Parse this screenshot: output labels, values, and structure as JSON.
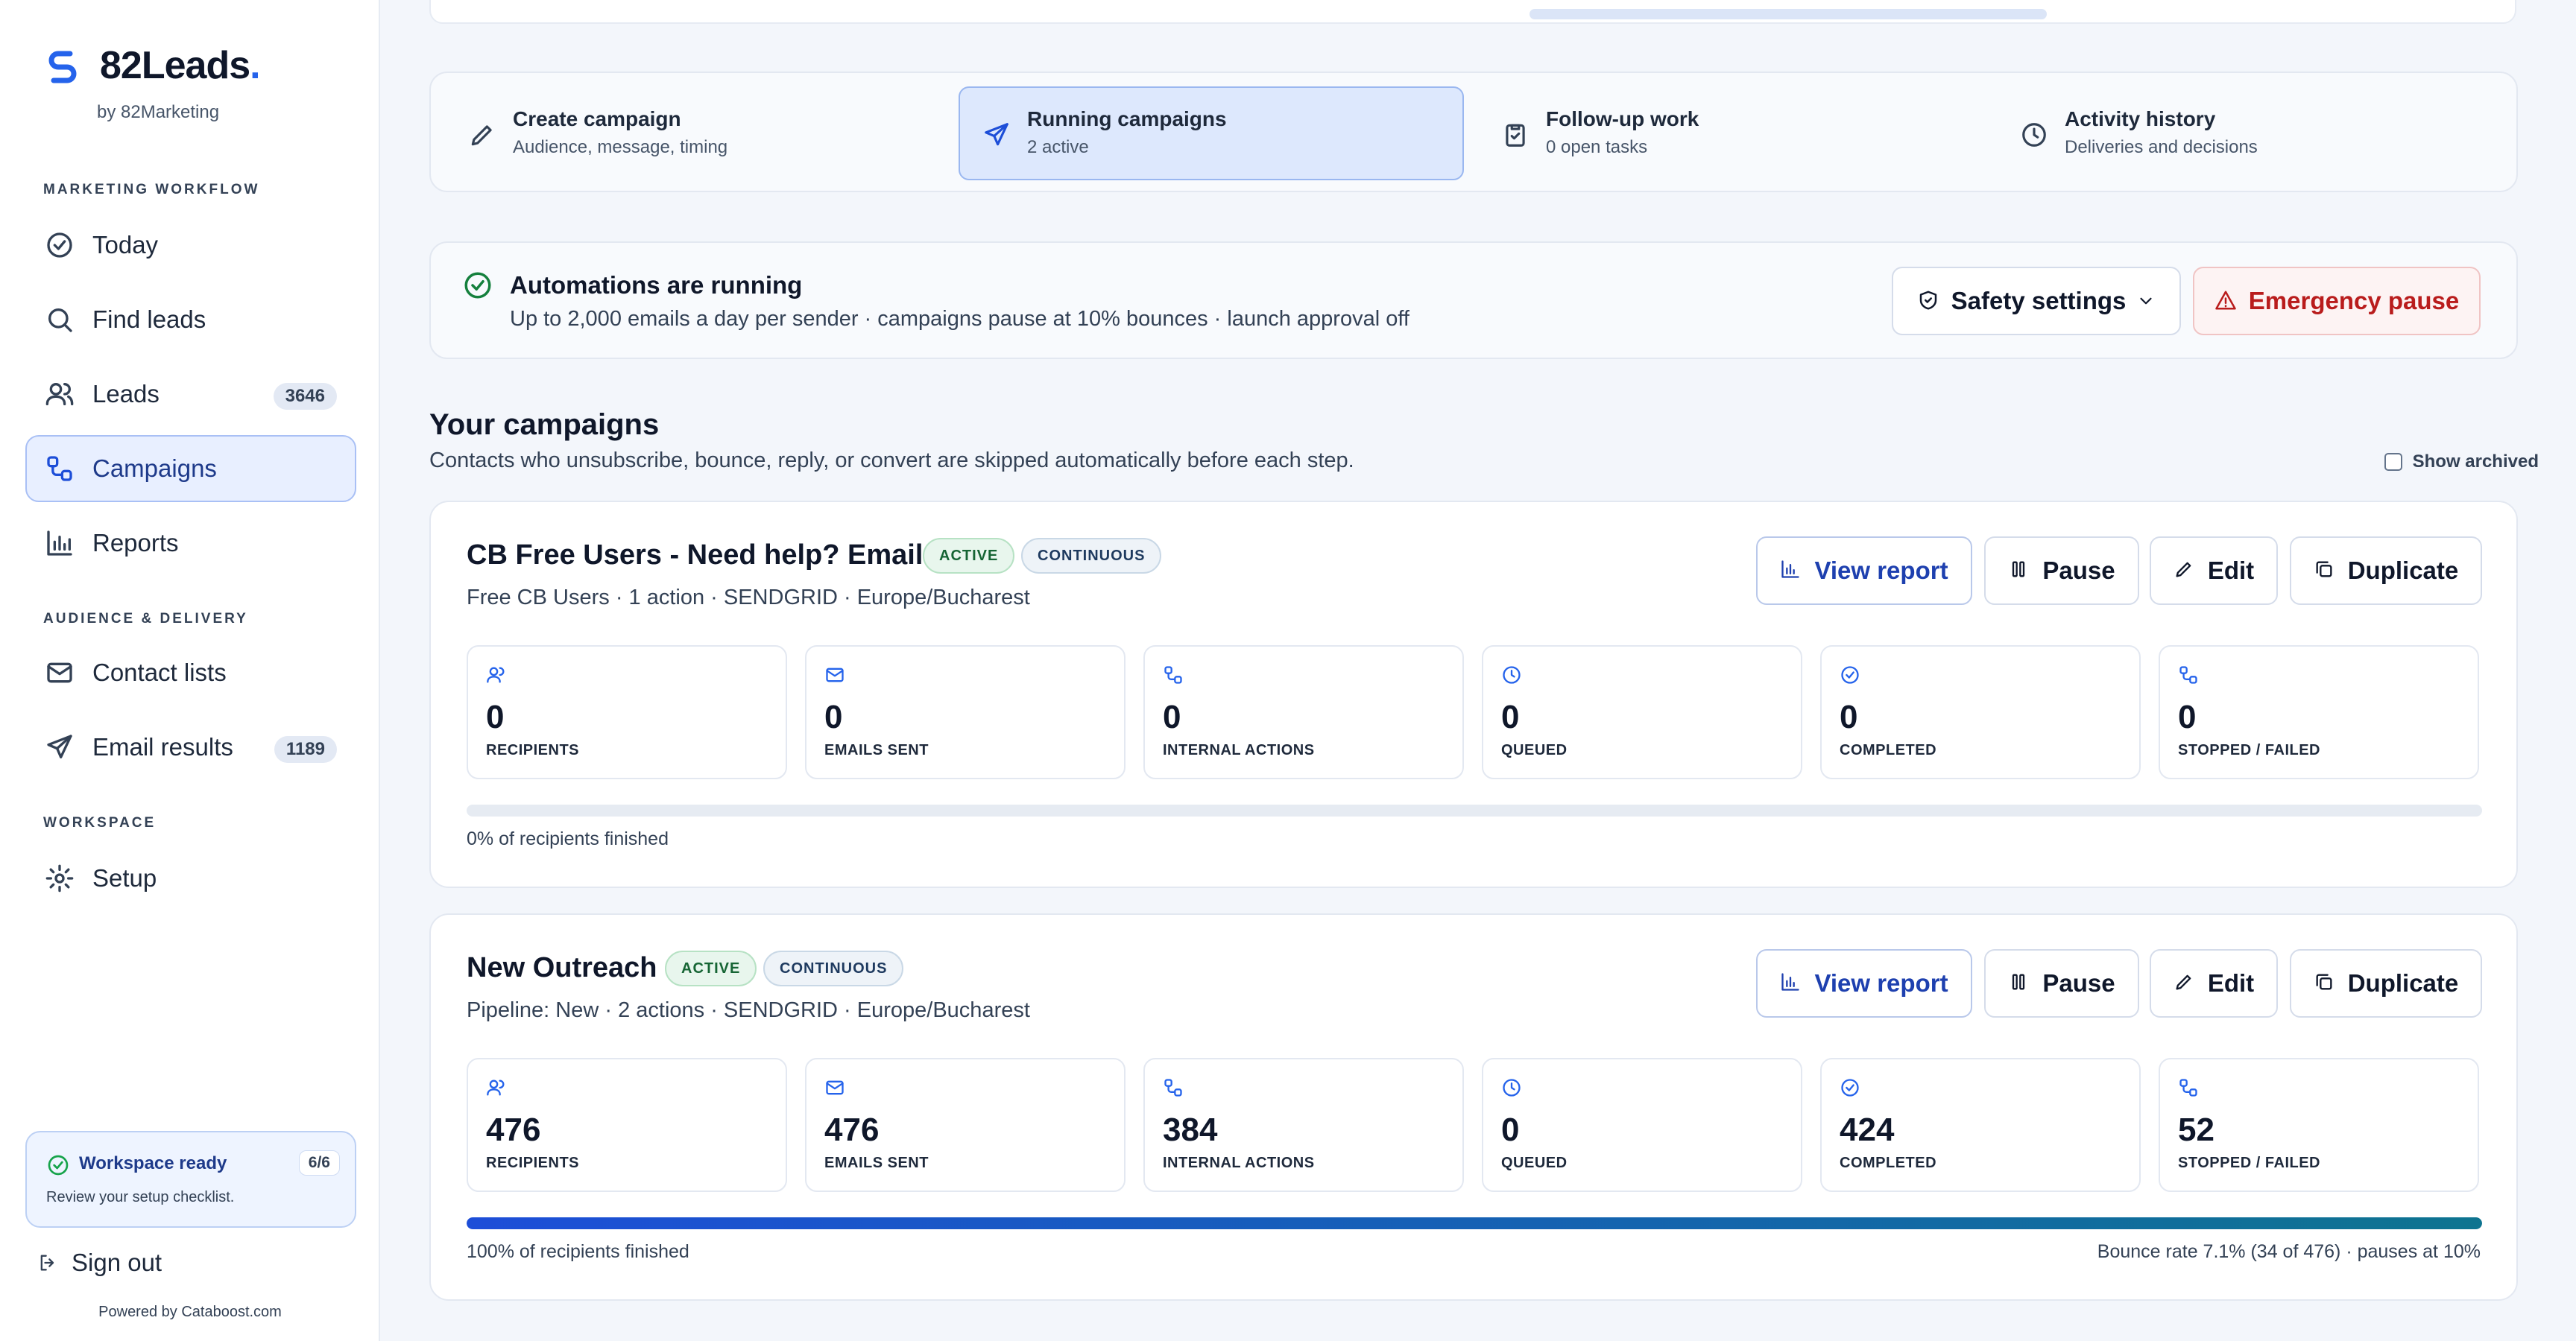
{
  "brand": {
    "name": "82Leads",
    "dot": ".",
    "subtitle": "by 82Marketing"
  },
  "sidebar": {
    "sections": [
      {
        "label": "MARKETING WORKFLOW"
      },
      {
        "label": "AUDIENCE & DELIVERY"
      },
      {
        "label": "WORKSPACE"
      }
    ],
    "items": [
      {
        "label": "Today"
      },
      {
        "label": "Find leads"
      },
      {
        "label": "Leads",
        "badge": "3646"
      },
      {
        "label": "Campaigns"
      },
      {
        "label": "Reports"
      },
      {
        "label": "Contact lists"
      },
      {
        "label": "Email results",
        "badge": "1189"
      },
      {
        "label": "Setup"
      }
    ],
    "ready": {
      "title": "Workspace ready",
      "count": "6/6",
      "subtitle": "Review your setup checklist."
    },
    "signout": "Sign out",
    "powered": "Powered by Cataboost.com"
  },
  "steps": [
    {
      "title": "Create campaign",
      "subtitle": "Audience, message, timing"
    },
    {
      "title": "Running campaigns",
      "subtitle": "2 active"
    },
    {
      "title": "Follow-up work",
      "subtitle": "0 open tasks"
    },
    {
      "title": "Activity history",
      "subtitle": "Deliveries and decisions"
    }
  ],
  "automation": {
    "title": "Automations are running",
    "subtitle": "Up to 2,000 emails a day per sender · campaigns pause at 10% bounces · launch approval off",
    "safety_label": "Safety settings",
    "emergency_label": "Emergency pause"
  },
  "campaigns_section": {
    "title": "Your campaigns",
    "subtitle": "Contacts who unsubscribe, bounce, reply, or convert are skipped automatically before each step.",
    "archived_label": "Show archived"
  },
  "actions": {
    "view_report": "View report",
    "pause": "Pause",
    "edit": "Edit",
    "duplicate": "Duplicate"
  },
  "campaigns": [
    {
      "title": "CB Free Users - Need help? Email.",
      "status": "ACTIVE",
      "mode": "CONTINUOUS",
      "meta": "Free CB Users · 1 action · SENDGRID · Europe/Bucharest",
      "stats": [
        {
          "value": "0",
          "label": "RECIPIENTS"
        },
        {
          "value": "0",
          "label": "EMAILS SENT"
        },
        {
          "value": "0",
          "label": "INTERNAL ACTIONS"
        },
        {
          "value": "0",
          "label": "QUEUED"
        },
        {
          "value": "0",
          "label": "COMPLETED"
        },
        {
          "value": "0",
          "label": "STOPPED / FAILED"
        }
      ],
      "progress": 0,
      "finished_text": "0% of recipients finished",
      "bounce_text": ""
    },
    {
      "title": "New Outreach",
      "status": "ACTIVE",
      "mode": "CONTINUOUS",
      "meta": "Pipeline: New · 2 actions · SENDGRID · Europe/Bucharest",
      "stats": [
        {
          "value": "476",
          "label": "RECIPIENTS"
        },
        {
          "value": "476",
          "label": "EMAILS SENT"
        },
        {
          "value": "384",
          "label": "INTERNAL ACTIONS"
        },
        {
          "value": "0",
          "label": "QUEUED"
        },
        {
          "value": "424",
          "label": "COMPLETED"
        },
        {
          "value": "52",
          "label": "STOPPED / FAILED"
        }
      ],
      "progress": 1,
      "finished_text": "100% of recipients finished",
      "bounce_text": "Bounce rate 7.1% (34 of 476) · pauses at 10%"
    }
  ]
}
